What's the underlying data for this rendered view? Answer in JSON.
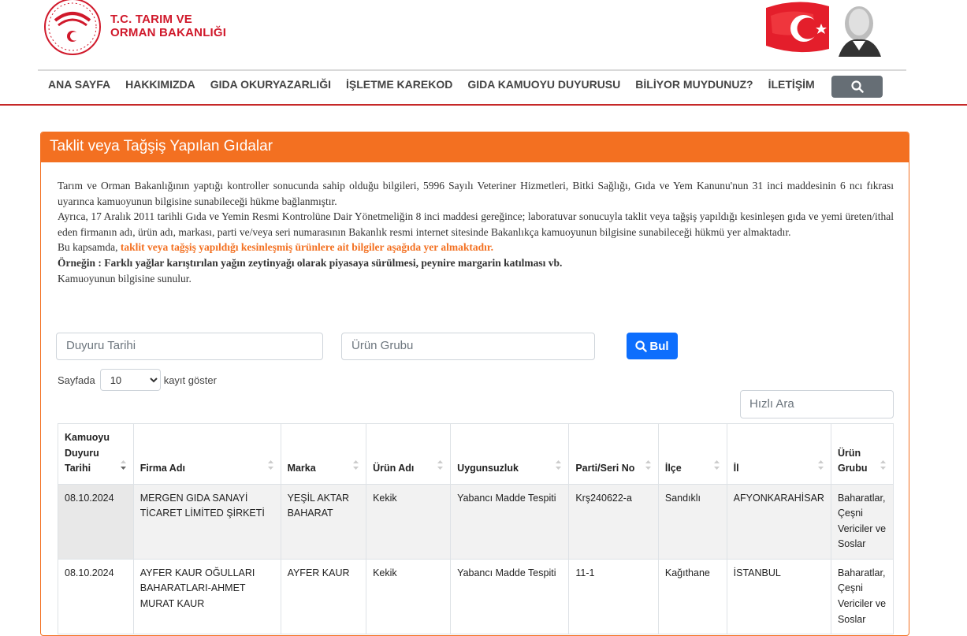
{
  "brand": {
    "line1": "T.C. TARIM VE",
    "line2": "ORMAN BAKANLIĞI",
    "logo_icon": "ministry-seal-icon",
    "flag_icon": "turkish-flag-ataturk-image",
    "accent": "#d0192b"
  },
  "nav": [
    {
      "label": "ANA SAYFA"
    },
    {
      "label": "HAKKIMIZDA"
    },
    {
      "label": "GIDA OKURYAZARLIĞI"
    },
    {
      "label": "İŞLETME KAREKOD"
    },
    {
      "label": "GIDA KAMUOYU DUYURUSU"
    },
    {
      "label": "BİLİYOR MUYDUNUZ?"
    },
    {
      "label": "İLETİŞİM"
    }
  ],
  "panel": {
    "title": "Taklit veya Tağşiş Yapılan Gıdalar",
    "color": "#f37021",
    "p1": "Tarım ve Orman Bakanlığının yaptığı kontroller sonucunda sahip olduğu bilgileri, 5996 Sayılı Veteriner Hizmetleri, Bitki Sağlığı, Gıda ve Yem Kanunu'nun 31 inci maddesinin 6 ncı fıkrası uyarınca kamuoyunun bilgisine sunabileceği hükme bağlanmıştır.",
    "p2": "Ayrıca, 17 Aralık 2011 tarihli Gıda ve Yemin Resmi Kontrolüne Dair Yönetmeliğin 8 inci maddesi gereğince; laboratuvar sonucuyla taklit veya tağşiş yapıldığı kesinleşen gıda ve yemi üreten/ithal eden firmanın adı, ürün adı, markası, parti ve/veya seri numarasının Bakanlık resmi internet sitesinde Bakanlıkça kamuoyunun bilgisine sunabileceği hükmü yer almaktadır.",
    "p3_prefix": "Bu kapsamda, ",
    "p3_highlight": "taklit veya tağşiş yapıldığı kesinleşmiş ürünlere ait bilgiler aşağıda yer almaktadır.",
    "p4": "Örneğin : Farklı yağlar karıştırılan yağın zeytinyağı olarak piyasaya sürülmesi, peynire margarin katılması vb.",
    "p5": "Kamuoyunun bilgisine sunulur."
  },
  "filters": {
    "date_placeholder": "Duyuru Tarihi",
    "group_placeholder": "Ürün Grubu",
    "search_label": "Bul",
    "page_prefix": "Sayfada",
    "page_size": "10",
    "page_suffix": "kayıt göster",
    "quick_search_placeholder": "Hızlı Ara"
  },
  "table": {
    "headers": [
      "Kamuoyu Duyuru Tarihi",
      "Firma Adı",
      "Marka",
      "Ürün Adı",
      "Uygunsuzluk",
      "Parti/Seri No",
      "İlçe",
      "İl",
      "Ürün Grubu"
    ],
    "rows": [
      {
        "date": "08.10.2024",
        "firm": "MERGEN GIDA SANAYİ TİCARET LİMİTED ŞİRKETİ",
        "brand": "YEŞİL AKTAR BAHARAT",
        "product": "Kekik",
        "issue": "Yabancı Madde Tespiti",
        "lot": "Krş240622-a",
        "district": "Sandıklı",
        "city": "AFYONKARAHİSAR",
        "group": "Baharatlar, Çeşni Vericiler ve Soslar"
      },
      {
        "date": "08.10.2024",
        "firm": "AYFER KAUR OĞULLARI BAHARATLARI-AHMET MURAT KAUR",
        "brand": "AYFER KAUR",
        "product": "Kekik",
        "issue": "Yabancı Madde Tespiti",
        "lot": "11-1",
        "district": "Kağıthane",
        "city": "İSTANBUL",
        "group": "Baharatlar, Çeşni Vericiler ve Soslar"
      }
    ]
  }
}
